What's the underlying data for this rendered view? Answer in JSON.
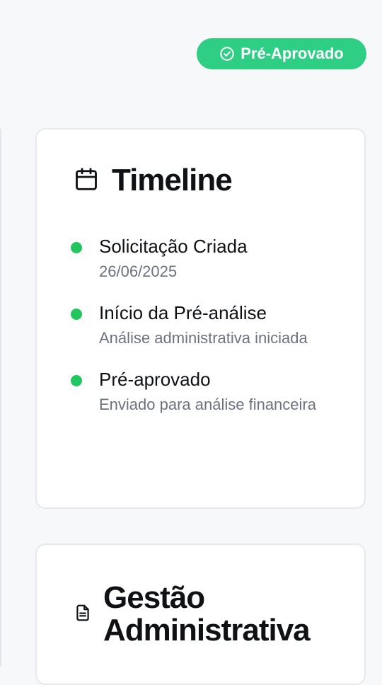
{
  "status": {
    "label": "Pré-Aprovado",
    "icon": "circle-check-icon",
    "color": "#2ecf84"
  },
  "timeline": {
    "title": "Timeline",
    "icon": "calendar-icon",
    "items": [
      {
        "title": "Solicitação Criada",
        "subtitle": "26/06/2025"
      },
      {
        "title": "Início da Pré-análise",
        "subtitle": "Análise administrativa iniciada"
      },
      {
        "title": "Pré-aprovado",
        "subtitle": "Enviado para análise financeira"
      }
    ],
    "dot_color": "#22c55e"
  },
  "gestao": {
    "title": "Gestão Administrativa",
    "icon": "document-icon"
  }
}
